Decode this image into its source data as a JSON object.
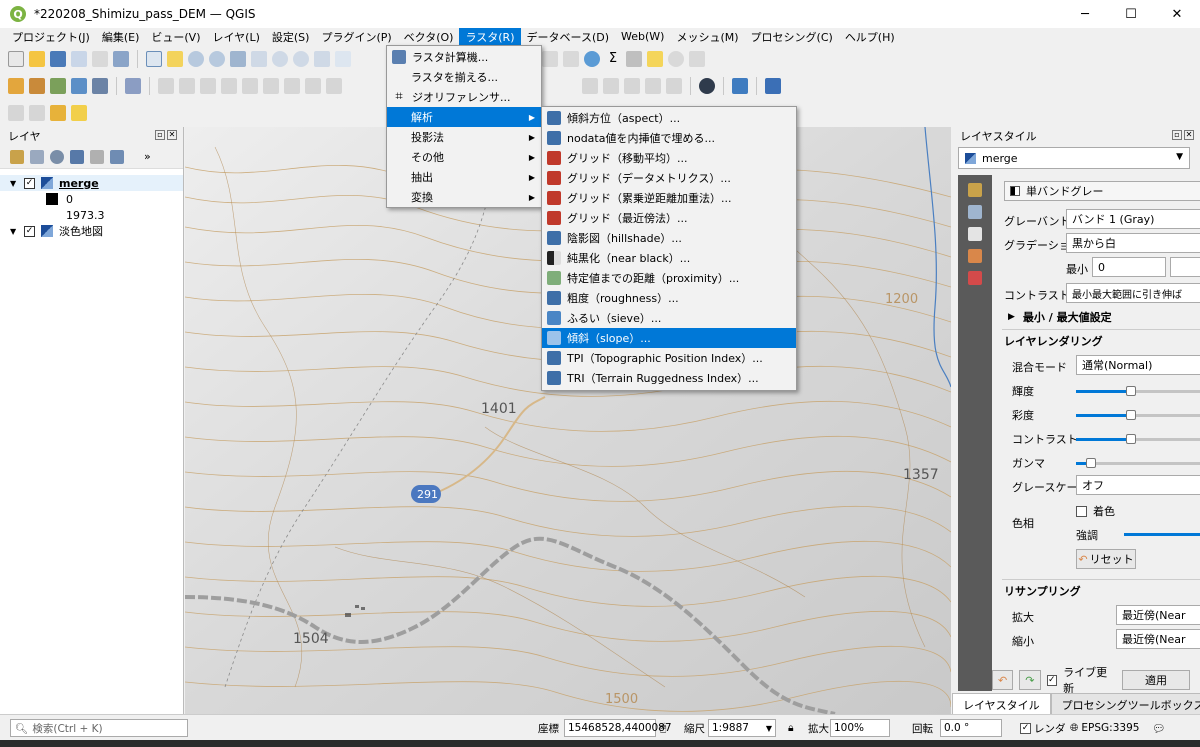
{
  "window": {
    "title": "*220208_Shimizu_pass_DEM — QGIS",
    "controls": [
      "─",
      "☐",
      "✕"
    ]
  },
  "menubar": [
    "プロジェクト(J)",
    "編集(E)",
    "ビュー(V)",
    "レイヤ(L)",
    "設定(S)",
    "プラグイン(P)",
    "ベクタ(O)",
    "ラスタ(R)",
    "データベース(D)",
    "Web(W)",
    "メッシュ(M)",
    "プロセシング(C)",
    "ヘルプ(H)"
  ],
  "raster_menu": {
    "items": [
      {
        "label": "ラスタ計算機..."
      },
      {
        "label": "ラスタを揃える..."
      },
      {
        "label": "ジオリファレンサ..."
      },
      {
        "label": "解析"
      },
      {
        "label": "投影法"
      },
      {
        "label": "その他"
      },
      {
        "label": "抽出"
      },
      {
        "label": "変換"
      }
    ]
  },
  "analysis_submenu": {
    "items": [
      {
        "label": "傾斜方位（aspect）..."
      },
      {
        "label": "nodata値を内挿値で埋める..."
      },
      {
        "label": "グリッド（移動平均）..."
      },
      {
        "label": "グリッド（データメトリクス）..."
      },
      {
        "label": "グリッド（累乗逆距離加重法）..."
      },
      {
        "label": "グリッド（最近傍法）..."
      },
      {
        "label": "陰影図（hillshade）..."
      },
      {
        "label": "純黒化（near black）..."
      },
      {
        "label": "特定値までの距離（proximity）..."
      },
      {
        "label": "粗度（roughness）..."
      },
      {
        "label": "ふるい（sieve）..."
      },
      {
        "label": "傾斜（slope）..."
      },
      {
        "label": "TPI（Topographic Position Index）..."
      },
      {
        "label": "TRI（Terrain Ruggedness Index）..."
      }
    ]
  },
  "layers_panel": {
    "title": "レイヤ",
    "layers": [
      {
        "name": "merge",
        "checked": true,
        "legend_min": "0",
        "legend_max": "1973.3"
      },
      {
        "name": "淡色地図",
        "checked": true
      }
    ]
  },
  "map": {
    "labels": [
      "1401",
      "291",
      "1357",
      "1504",
      "1500",
      "1200"
    ]
  },
  "style_panel": {
    "title": "レイヤスタイル",
    "layer": "merge",
    "renderer": "単バンドグレー",
    "gray_band_label": "グレーバンド",
    "gray_band_value": "バンド 1 (Gray)",
    "gradient_label": "グラデーション",
    "gradient_value": "黒から白",
    "min_label": "最小",
    "min_value": "0",
    "contrast_label": "コントラスト",
    "contrast_value": "最小最大範囲に引き伸ば",
    "minmax_settings": "最小 / 最大値設定",
    "layer_rendering": "レイヤレンダリング",
    "blend_label": "混合モード",
    "blend_value": "通常(Normal)",
    "brightness_label": "輝度",
    "saturation_label": "彩度",
    "contrast2_label": "コントラスト",
    "gamma_label": "ガンマ",
    "grayscale_label": "グレースケール",
    "grayscale_value": "オフ",
    "colorize_label": "色相",
    "colorize_check": "着色",
    "strength_label": "強調",
    "reset_button": "リセット",
    "resampling": "リサンプリング",
    "zoom_in_label": "拡大",
    "zoom_in_value": "最近傍(Near",
    "zoom_out_label": "縮小",
    "zoom_out_value": "最近傍(Near",
    "live_update": "ライブ更新",
    "apply_button": "適用",
    "tabs": [
      "レイヤスタイル",
      "プロセシングツールボックス"
    ]
  },
  "statusbar": {
    "search_placeholder": "検索(Ctrl + K)",
    "coord_label": "座標",
    "coord_value": "15468528,4400087",
    "scale_label": "縮尺",
    "scale_value": "1:9887",
    "magnify_label": "拡大",
    "magnify_value": "100%",
    "rotation_label": "回転",
    "rotation_value": "0.0 °",
    "render_label": "レンダ",
    "crs": "EPSG:3395"
  },
  "colors": {
    "accent": "#0078d7",
    "qgis_green": "#7cb342",
    "contour": "#c8a46e"
  }
}
